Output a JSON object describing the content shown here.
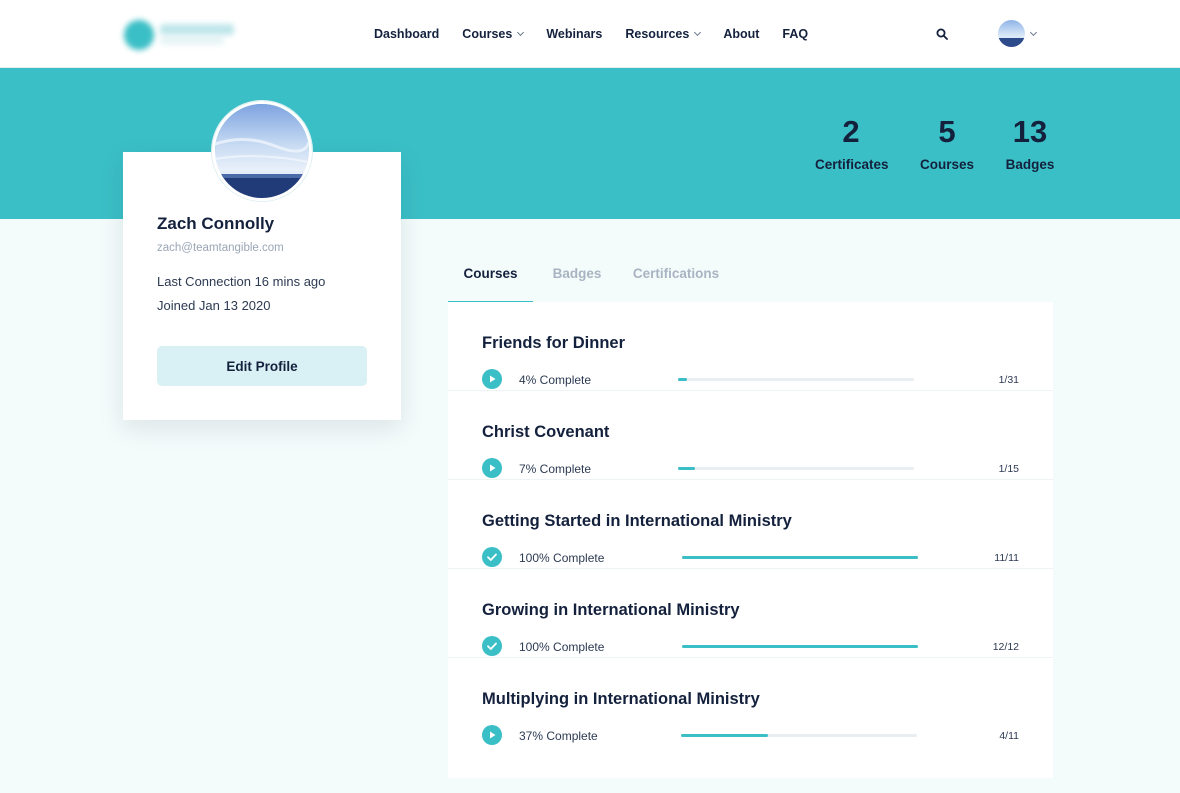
{
  "nav": {
    "items": [
      {
        "label": "Dashboard",
        "dropdown": false
      },
      {
        "label": "Courses",
        "dropdown": true
      },
      {
        "label": "Webinars",
        "dropdown": false
      },
      {
        "label": "Resources",
        "dropdown": true
      },
      {
        "label": "About",
        "dropdown": false
      },
      {
        "label": "FAQ",
        "dropdown": false
      }
    ],
    "icons": {
      "search": "search-icon",
      "user_menu": "chevron-down-icon"
    }
  },
  "stats": [
    {
      "value": "2",
      "label": "Certificates"
    },
    {
      "value": "5",
      "label": "Courses"
    },
    {
      "value": "13",
      "label": "Badges"
    }
  ],
  "profile": {
    "name": "Zach Connolly",
    "email": "zach@teamtangible.com",
    "last_connection": "Last Connection 16 mins ago",
    "joined": "Joined Jan 13 2020",
    "edit_label": "Edit Profile"
  },
  "tabs": [
    {
      "label": "Courses",
      "active": true
    },
    {
      "label": "Badges",
      "active": false
    },
    {
      "label": "Certifications",
      "active": false
    }
  ],
  "courses": [
    {
      "title": "Friends for Dinner",
      "status_text": "4% Complete",
      "progress": 0.04,
      "count": "1/31",
      "icon": "play-icon"
    },
    {
      "title": "Christ Covenant",
      "status_text": "7% Complete",
      "progress": 0.07,
      "count": "1/15",
      "icon": "play-icon"
    },
    {
      "title": "Getting Started in International Ministry",
      "status_text": "100% Complete",
      "progress": 1.0,
      "count": "11/11",
      "icon": "check-icon"
    },
    {
      "title": "Growing in International Ministry",
      "status_text": "100% Complete",
      "progress": 1.0,
      "count": "12/12",
      "icon": "check-icon"
    },
    {
      "title": "Multiplying in International Ministry",
      "status_text": "37% Complete",
      "progress": 0.37,
      "count": "4/11",
      "icon": "play-icon"
    }
  ],
  "colors": {
    "accent": "#3bbfc6",
    "ink": "#14213d",
    "page_bg": "#f3fbfb"
  }
}
